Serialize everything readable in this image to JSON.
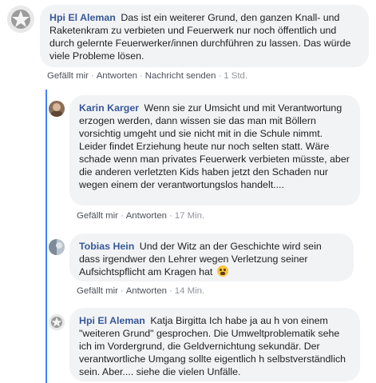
{
  "comments": [
    {
      "author": "Hpi El Aleman",
      "text": "Das ist ein weiterer Grund, den ganzen Knall- und Raketenkram zu verbieten und Feuerwerk nur noch öffentlich und durch gelernte Feuerwerker/innen durchführen zu lassen. Das würde viele Probleme lösen.",
      "actions": {
        "like": "Gefällt mir",
        "reply": "Antworten",
        "message": "Nachricht senden",
        "time": "1 Std."
      }
    },
    {
      "author": "Karin Karger",
      "text": "Wenn sie zur Umsicht und mit Verantwortung erzogen werden, dann wissen sie das man mit Böllern vorsichtig umgeht und sie nicht mit in die Schule nimmt. Leider findet Erziehung heute nur noch selten statt. Wäre schade wenn man privates Feuerwerk verbieten müsste, aber die anderen verletzten Kids haben jetzt den Schaden nur wegen einem der verantwortungslos handelt....",
      "actions": {
        "like": "Gefällt mir",
        "reply": "Antworten",
        "time": "17 Min."
      }
    },
    {
      "author": "Tobias Hein",
      "text": "Und der Witz an der Geschichte wird sein dass irgendwer den Lehrer wegen Verletzung seiner Aufsichtspflicht am Kragen hat",
      "emoji": "scream-emoji",
      "actions": {
        "like": "Gefällt mir",
        "reply": "Antworten",
        "time": "14 Min."
      }
    },
    {
      "author": "Hpi El Aleman",
      "text": "Katja Birgitta Ich habe ja au h von einem \"weiteren Grund\" gesprochen. Die Umweltproblematik sehe ich im Vordergrund, die Geldvernichtung sekundär. Der verantwortliche Umgang sollte eigentlich h selbstverständlich sein. Aber.... siehe die vielen Unfälle."
    }
  ],
  "colors": {
    "author": "#385898",
    "thread_line": "#4080ff",
    "bubble": "#f2f3f5"
  }
}
